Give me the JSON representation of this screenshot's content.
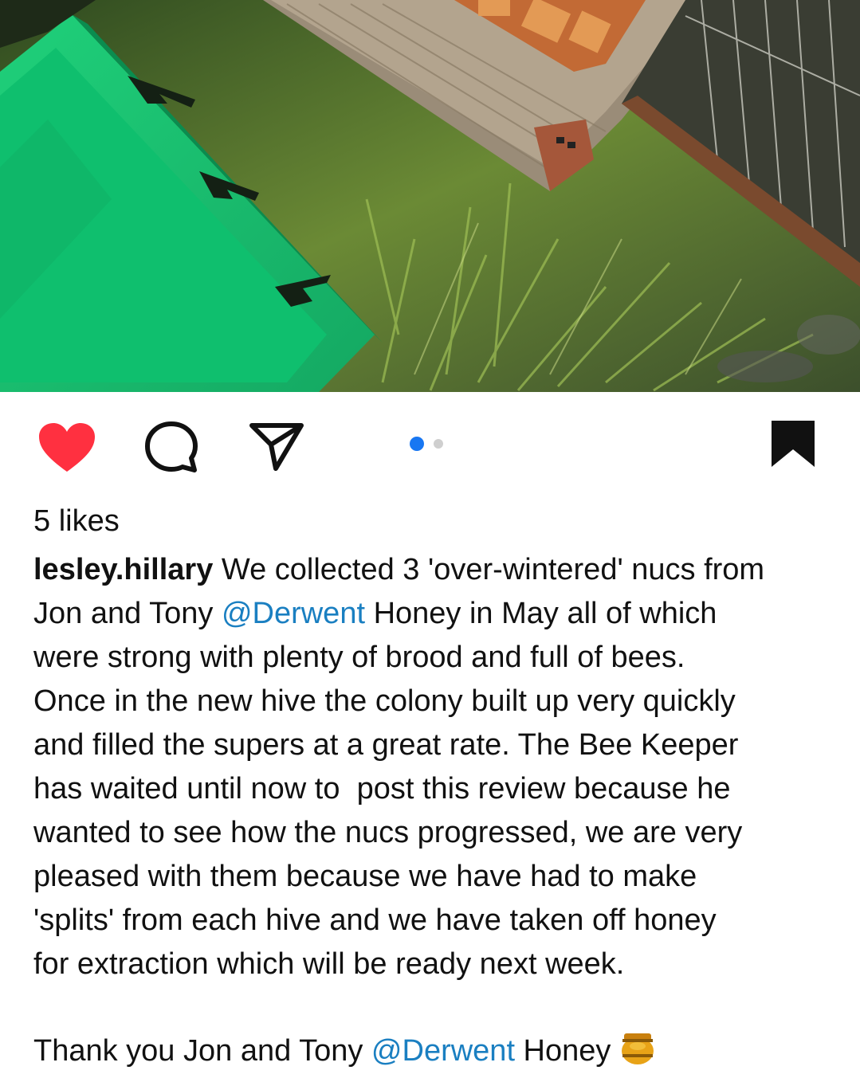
{
  "post": {
    "image_alt": "",
    "carousel": {
      "total": 2,
      "active": 1
    },
    "liked": true,
    "saved": true
  },
  "icons": {
    "like": "heart-icon",
    "comment": "comment-bubble-icon",
    "share": "paper-plane-icon",
    "save": "bookmark-icon",
    "honey": "honey-pot-emoji"
  },
  "colors": {
    "like_red": "#ff3040",
    "mention_blue": "#1a7fc1",
    "carousel_active": "#1877f2",
    "carousel_inactive": "#cfcfcf"
  },
  "likes": "5 likes",
  "caption": {
    "username": "lesley.hillary",
    "line1_rest": " We collected 3 'over-wintered' nucs from",
    "line2_a": "Jon and Tony ",
    "mention": "@Derwent",
    "line2_b": " Honey in May all of which",
    "line3": "were strong with plenty of brood and full of bees.",
    "line4": "Once in the new hive the colony built up very quickly",
    "line5": "and filled the supers at a great rate. The Bee Keeper",
    "line6": "has waited until now to  post this review because he",
    "line7": "wanted to see how the nucs progressed, we are very",
    "line8": "pleased with them because we have had to make",
    "line9": "'splits' from each hive and we have taken off honey",
    "line10": "for extraction which will be ready next week.",
    "thanks_a": "Thank you Jon and Tony ",
    "thanks_mention": "@Derwent",
    "thanks_b": " Honey "
  }
}
